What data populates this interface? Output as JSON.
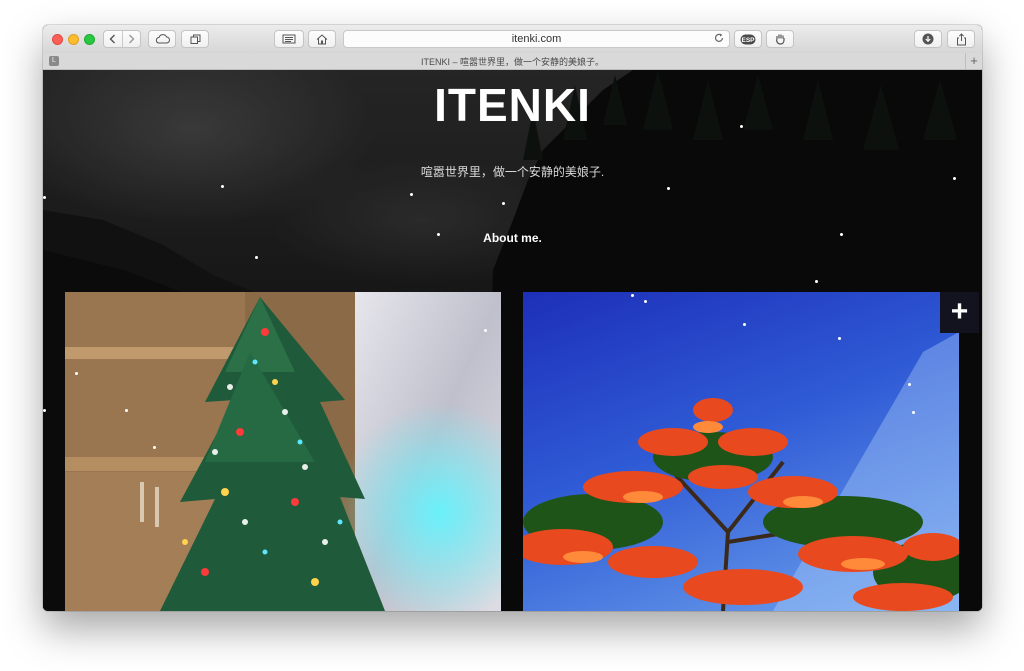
{
  "browser": {
    "url": "itenki.com",
    "tab_title": "ITENKI – 喧嚣世界里，做一个安静的美娘子。",
    "back_icon": "chevron-left-icon",
    "forward_icon": "chevron-right-icon",
    "icloud_icon": "cloud-icon",
    "tabs_icon": "tabs-icon",
    "reader_icon": "reader-icon",
    "home_icon": "home-icon",
    "reload_icon": "reload-icon",
    "download_icon": "download-icon",
    "share_icon": "share-icon"
  },
  "site": {
    "title": "ITENKI",
    "subtitle": "喧嚣世界里，做一个安静的美娘子.",
    "about_link": "About me.",
    "expand_label": "+"
  },
  "colors": {
    "background": "#1c1c1c",
    "title": "#ffffff",
    "plus_button_bg": "#12131f",
    "photo_sky": "#2f5bd6",
    "flower_red": "#e8491f"
  }
}
